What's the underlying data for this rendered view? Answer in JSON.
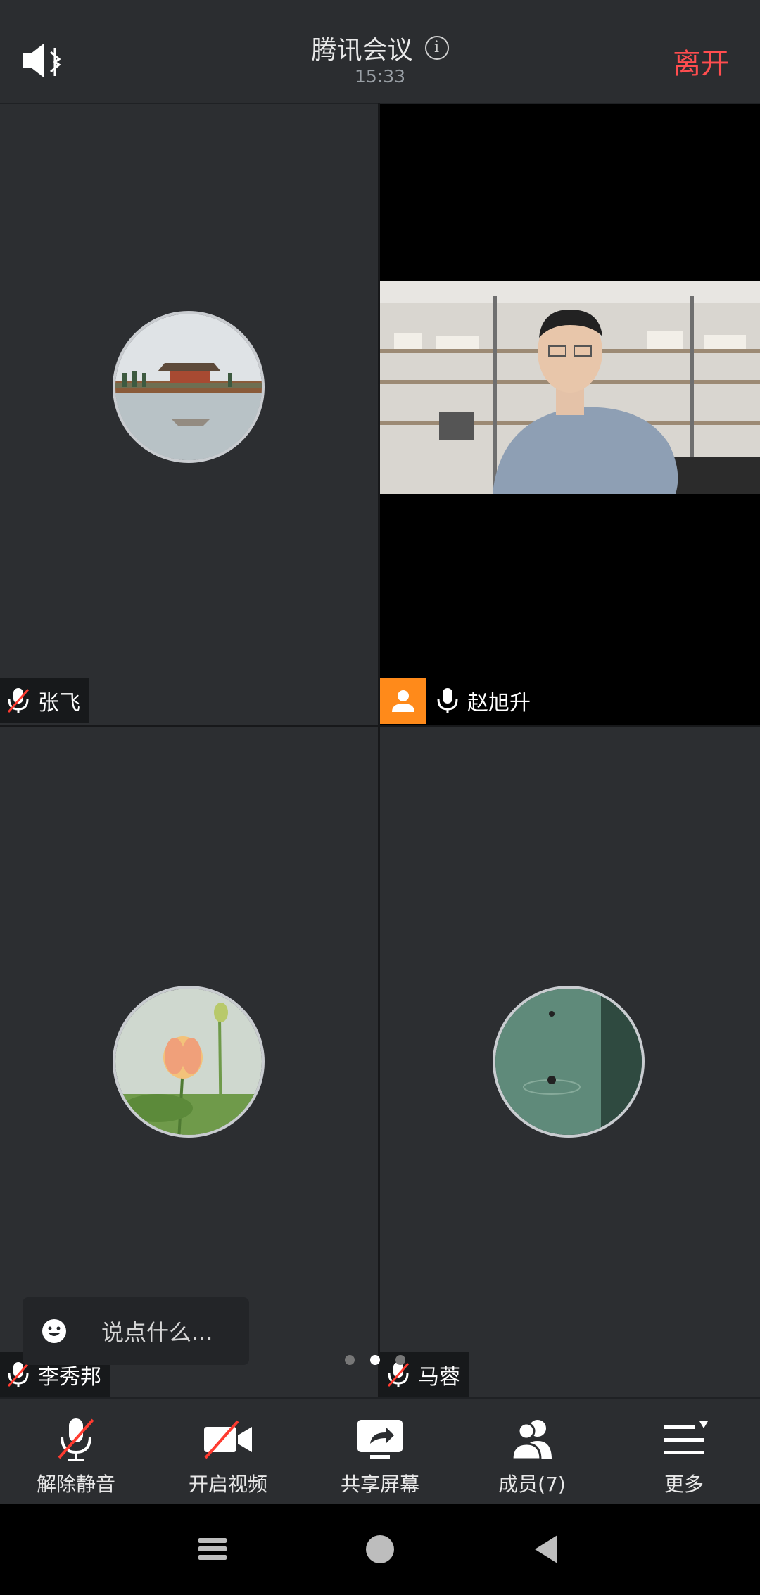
{
  "header": {
    "title": "腾讯会议",
    "time": "15:33",
    "leave_label": "离开"
  },
  "participants": [
    {
      "name": "张飞",
      "mic": "muted"
    },
    {
      "name": "赵旭升",
      "mic": "on"
    },
    {
      "name": "李秀邦",
      "mic": "muted"
    },
    {
      "name": "马蓉",
      "mic": "muted"
    }
  ],
  "chat": {
    "placeholder": "说点什么..."
  },
  "pager": {
    "pages": 3,
    "active": 2
  },
  "toolbar": {
    "unmute": "解除静音",
    "video": "开启视频",
    "share": "共享屏幕",
    "members": "成员(7)",
    "more": "更多"
  },
  "colors": {
    "leave": "#ff4d4f",
    "active_speaker": "#ff8a1a"
  }
}
